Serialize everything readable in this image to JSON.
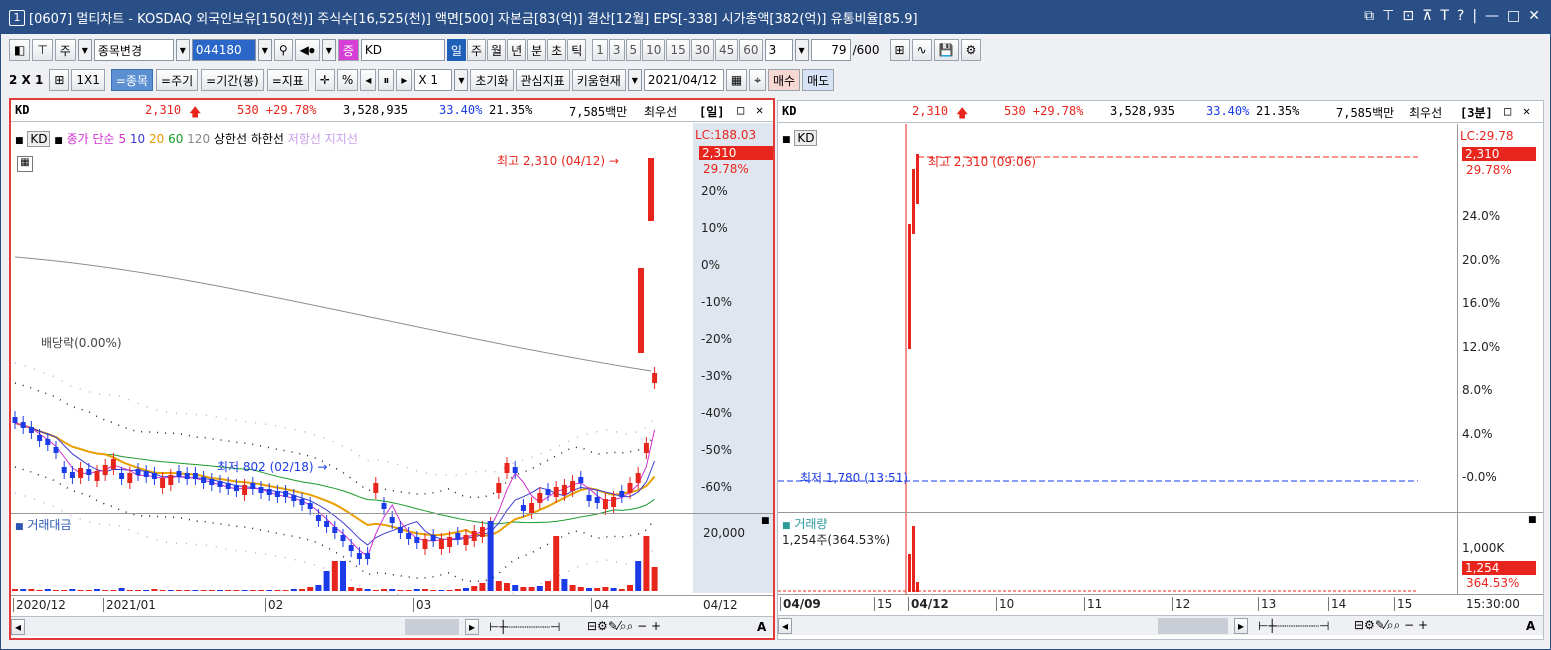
{
  "title": "[0607] 멀티차트 - KOSDAQ 외국인보유[150(천)] 주식수[16,525(천)] 액면[500] 자본금[83(억)] 결산[12월] EPS[-338] 시가총액[382(억)] 유통비율[85.9]",
  "window_no": "1",
  "title_controls": [
    "⧉",
    "⊤",
    "⊡",
    "⊼",
    "T",
    "?",
    "|",
    "—",
    "□",
    "✕"
  ],
  "toolbar1": {
    "type_label": "주",
    "menu_label": "종목변경",
    "code": "044180",
    "market_badge": "증",
    "name": "KD",
    "periods": [
      "일",
      "주",
      "월",
      "년",
      "분",
      "초",
      "틱"
    ],
    "active_period": "일",
    "intervals": [
      "1",
      "3",
      "5",
      "10",
      "15",
      "30",
      "45",
      "60"
    ],
    "count_sel": "3",
    "count": "79",
    "count_max": "/600"
  },
  "toolbar2": {
    "layout": "2 X 1",
    "layout_btn": "1X1",
    "tabs": [
      "=종목",
      "=주기",
      "=기간(봉)",
      "=지표"
    ],
    "pct": "%",
    "ratio": "X 1",
    "reset": "초기화",
    "interest": "관심지표",
    "kiwoom": "키움현재",
    "date": "2021/04/12",
    "buy": "매수",
    "sell": "매도"
  },
  "left": {
    "name": "KD",
    "price": "2,310",
    "change": "530 +29.78%",
    "volume": "3,528,935",
    "rate1": "33.40%",
    "rate2": "21.35%",
    "amount": "7,585백만",
    "quote": "최우선",
    "period": "[일]",
    "legend": {
      "code": "KD",
      "ma_label": "종가 단순",
      "ma": [
        {
          "n": "5",
          "c": "#d12fd1"
        },
        {
          "n": "10",
          "c": "#3b3bd1"
        },
        {
          "n": "20",
          "c": "#e89b00"
        },
        {
          "n": "60",
          "c": "#1b9a2a"
        },
        {
          "n": "120",
          "c": "#888888"
        }
      ],
      "up": "상한선",
      "down": "하한선",
      "res": "저항선",
      "sup": "지지선"
    },
    "lc": "LC:188.03",
    "price_tag": "2,310",
    "price_pct": "29.78%",
    "yticks": [
      "20%",
      "10%",
      "0%",
      "-10%",
      "-20%",
      "-30%",
      "-40%",
      "-50%",
      "-60%"
    ],
    "high": "최고 2,310 (04/12) →",
    "low": "최저 802 (02/18) →",
    "annot": "배당락(0.00%)",
    "vol_title": "거래대금",
    "vol_tick": "20,000",
    "xticks": [
      "2020/12",
      "2021/01",
      "02",
      "03",
      "04"
    ],
    "xlast": "04/12"
  },
  "right": {
    "name": "KD",
    "price": "2,310",
    "change": "530 +29.78%",
    "volume": "3,528,935",
    "rate1": "33.40%",
    "rate2": "21.35%",
    "amount": "7,585백만",
    "quote": "최우선",
    "period": "[3분]",
    "code": "KD",
    "lc": "LC:29.78",
    "price_tag": "2,310",
    "price_pct": "29.78%",
    "yticks": [
      "24.0%",
      "20.0%",
      "16.0%",
      "12.0%",
      "8.0%",
      "4.0%",
      "-0.0%"
    ],
    "high": "최고 2,310 (09:06)",
    "low": "최저 1,780 (13:51)",
    "vol_title": "거래량",
    "vol_sub": "1,254주(364.53%)",
    "vol_tick": "1,000K",
    "vol_tag": "1,254",
    "vol_pct": "364.53%",
    "xticks": [
      "04/09",
      "15",
      "04/12",
      "10",
      "11",
      "12",
      "13",
      "14",
      "15"
    ],
    "xlast": "15:30:00"
  },
  "scroll_a": "A"
}
